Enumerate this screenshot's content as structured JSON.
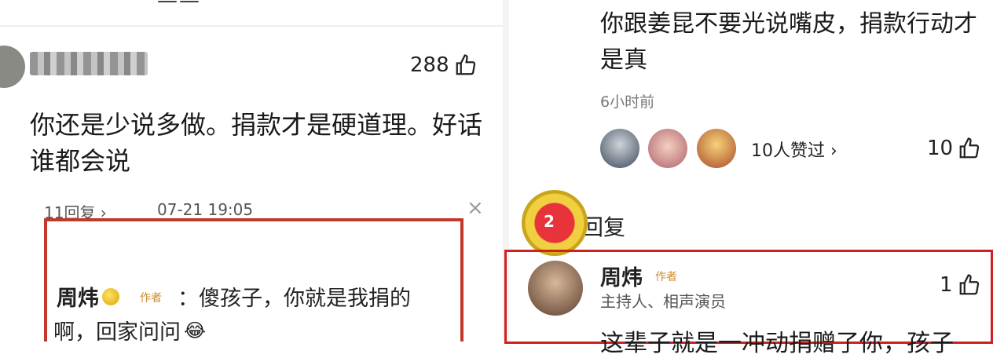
{
  "left": {
    "top_title": "——",
    "comment": {
      "likes": "288",
      "text": "你还是少说多做。捐款才是硬道理。好话谁都会说",
      "reply_count": "11回复 ›",
      "reply_date": "07-21 19:05",
      "close": "×"
    },
    "author_reply": {
      "name": "周炜",
      "tag": "作者",
      "text_line1": "：傻孩子，你就是我捐的",
      "text_line2": "啊，回家问问"
    }
  },
  "right": {
    "comment_text": "你跟姜昆不要光说嘴皮，捐款行动才是真",
    "time": "6小时前",
    "likers_label": "10人赞过 ›",
    "likes": "10",
    "reply_section_title": "回复",
    "medal_number": "2",
    "author_reply": {
      "name": "周炜",
      "tag": "作者",
      "role": "主持人、相声演员",
      "likes": "1",
      "partial_text": "这辈子就是一冲动捐赠了你，孩子"
    }
  },
  "icons": [
    "thumbs-up-icon",
    "close-icon",
    "gold-badge-icon",
    "laughing-emoji-icon",
    "medal-icon"
  ],
  "colors": {
    "highlight_red": "#c0392b",
    "tag_orange": "#d08a2a",
    "medal_gold": "#f0d040"
  }
}
